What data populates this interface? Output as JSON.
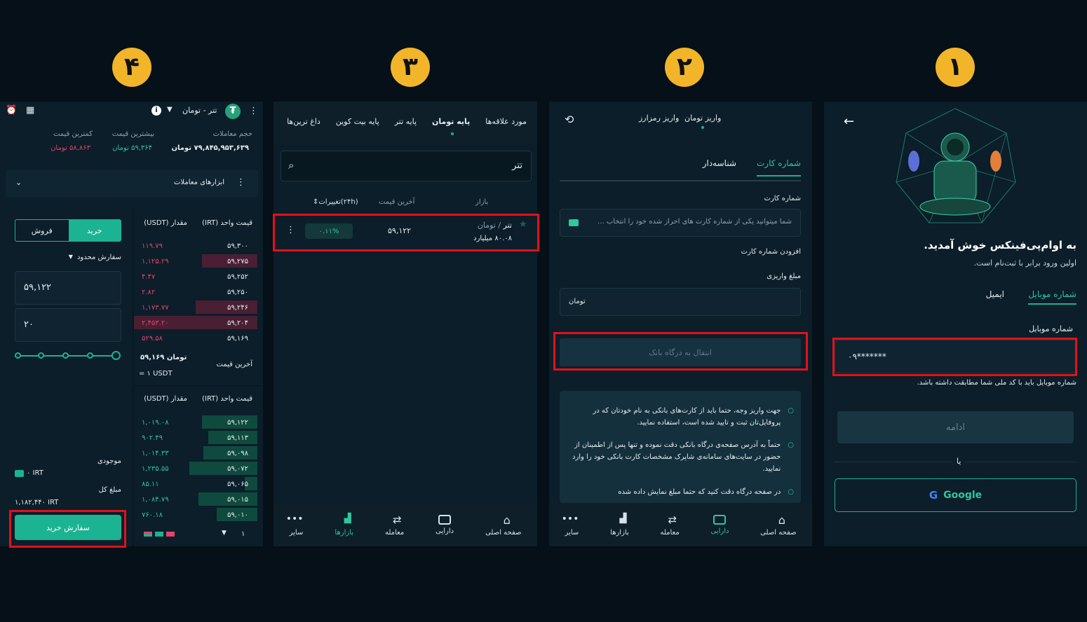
{
  "steps": [
    "۱",
    "۲",
    "۳",
    "۴"
  ],
  "panel1": {
    "welcome_title": "به اوام‌پی‌فینکس خوش آمدید.",
    "welcome_sub": "اولین ورود برابر با ثبت‌نام است.",
    "tab_mobile": "شماره موبایل",
    "tab_email": "ایمیل",
    "field_label": "شماره موبایل",
    "field_value": "۰۹*******",
    "hint": "شماره موبایل باید با کد ملی شما مطابقت داشته باشد.",
    "continue": "ادامه",
    "or": "یا",
    "google": "Google"
  },
  "panel2": {
    "tab_toman": "واریز تومان",
    "tab_crypto": "واریز رمزارز",
    "subtab_card": "شماره کارت",
    "subtab_id": "شناسه‌دار",
    "card_label": "شماره کارت",
    "card_placeholder": "شما میتوانید یکی از شماره کارت های احراز شده خود را انتخاب ...",
    "add_card": "افزودن شماره کارت",
    "amount_label": "مبلغ واریزی",
    "amount_unit": "تومان",
    "gateway_btn": "انتقال به درگاه بانک",
    "notes": [
      "جهت واریز وجه، حتما باید از کارت‌های بانکی به نام خودتان که در پروفایل‌تان ثبت و تایید شده است، استفاده نمایید.",
      "حتماً به آدرس صفحه‌ی درگاه بانکی دقت نموده و تنها پس از اطمینان از حضور در سایت‌های سامانه‌ی شاپرک مشخصات کارت بانکی خود را وارد نمایید.",
      "در صفحه درگاه دقت کنید که حتما مبلغ نمایش داده شده"
    ],
    "nav": [
      "صفحه اصلی",
      "دارایی",
      "معامله",
      "بازارها",
      "سایر"
    ]
  },
  "panel3": {
    "tabs": [
      "مورد علاقه‌ها",
      "پایه تومان",
      "پایه تتر",
      "پایه بیت کوین",
      "داغ ترین‌ها"
    ],
    "search_value": "تتر",
    "col_market": "بازار",
    "col_last": "آخرین قیمت",
    "col_change": "تغییرات(۲۴h)",
    "row_name": "تتر",
    "row_quote": "/ تومان",
    "row_volume": "۸۰.۰۸ میلیارد",
    "row_price": "۵۹,۱۲۲",
    "row_change": "۰.۱۱%",
    "nav": [
      "صفحه اصلی",
      "دارایی",
      "معامله",
      "بازارها",
      "سایر"
    ]
  },
  "panel4": {
    "pair": "تتر - تومان",
    "vol_label": "حجم معاملات",
    "vol_value": "۷۹,۸۴۵,۹۵۳,۶۳۹ تومان",
    "high_label": "بیشترین قیمت",
    "high_value": "۵۹,۳۶۴ تومان",
    "low_label": "کمترین قیمت",
    "low_value": "۵۸,۸۶۳ تومان",
    "tools": "ابزارهای معاملات",
    "buy": "خرید",
    "sell": "فروش",
    "order_type": "سفارش محدود",
    "price_input": "۵۹,۱۲۲",
    "amount_input": "۲۰",
    "balance_label": "موجودی",
    "balance_value": "۰ IRT",
    "total_label": "مبلغ کل",
    "total_value": "۱,۱۸۲,۴۴۰ IRT",
    "submit": "سفارش خرید",
    "ob_price_col": "قیمت واحد (IRT)",
    "ob_amount_col": "مقدار (USDT)",
    "last_price_label": "آخرین قیمت",
    "last_price_value": "۵۹,۱۶۹ تومان",
    "last_price_usdt": "= ۱ USDT",
    "depth": "۱",
    "asks": [
      {
        "price": "۵۹,۳۰۰",
        "amount": "۱۱۹.۷۹",
        "depth": 0
      },
      {
        "price": "۵۹,۲۷۵",
        "amount": "۱,۱۲۵.۲۹",
        "depth": 0.45
      },
      {
        "price": "۵۹,۲۵۲",
        "amount": "۴.۴۷",
        "depth": 0
      },
      {
        "price": "۵۹,۲۵۰",
        "amount": "۲.۸۲",
        "depth": 0
      },
      {
        "price": "۵۹,۲۴۶",
        "amount": "۱,۱۷۳.۷۷",
        "depth": 0.5
      },
      {
        "price": "۵۹,۲۰۴",
        "amount": "۲,۴۵۳.۲۰",
        "depth": 1.0
      },
      {
        "price": "۵۹,۱۶۹",
        "amount": "۵۲۹.۵۸",
        "depth": 0
      }
    ],
    "bids": [
      {
        "price": "۵۹,۱۲۲",
        "amount": "۱,۰۱۹.۰۸",
        "depth": 0.45
      },
      {
        "price": "۵۹,۱۱۳",
        "amount": "۹۰۲.۴۹",
        "depth": 0.4
      },
      {
        "price": "۵۹,۰۹۸",
        "amount": "۱,۰۱۴.۳۳",
        "depth": 0.44
      },
      {
        "price": "۵۹,۰۷۲",
        "amount": "۱,۲۳۵.۵۵",
        "depth": 0.55
      },
      {
        "price": "۵۹,۰۶۵",
        "amount": "۸۵.۱۱",
        "depth": 0.1
      },
      {
        "price": "۵۹,۰۱۵",
        "amount": "۱,۰۸۴.۷۹",
        "depth": 0.48
      },
      {
        "price": "۵۹,۰۱۰",
        "amount": "۷۶۰.۱۸",
        "depth": 0.33
      }
    ]
  },
  "colors": {
    "accent": "#1bb392",
    "sell": "#e6416f",
    "badge": "#f2b52a",
    "highlight": "#e3101a"
  }
}
